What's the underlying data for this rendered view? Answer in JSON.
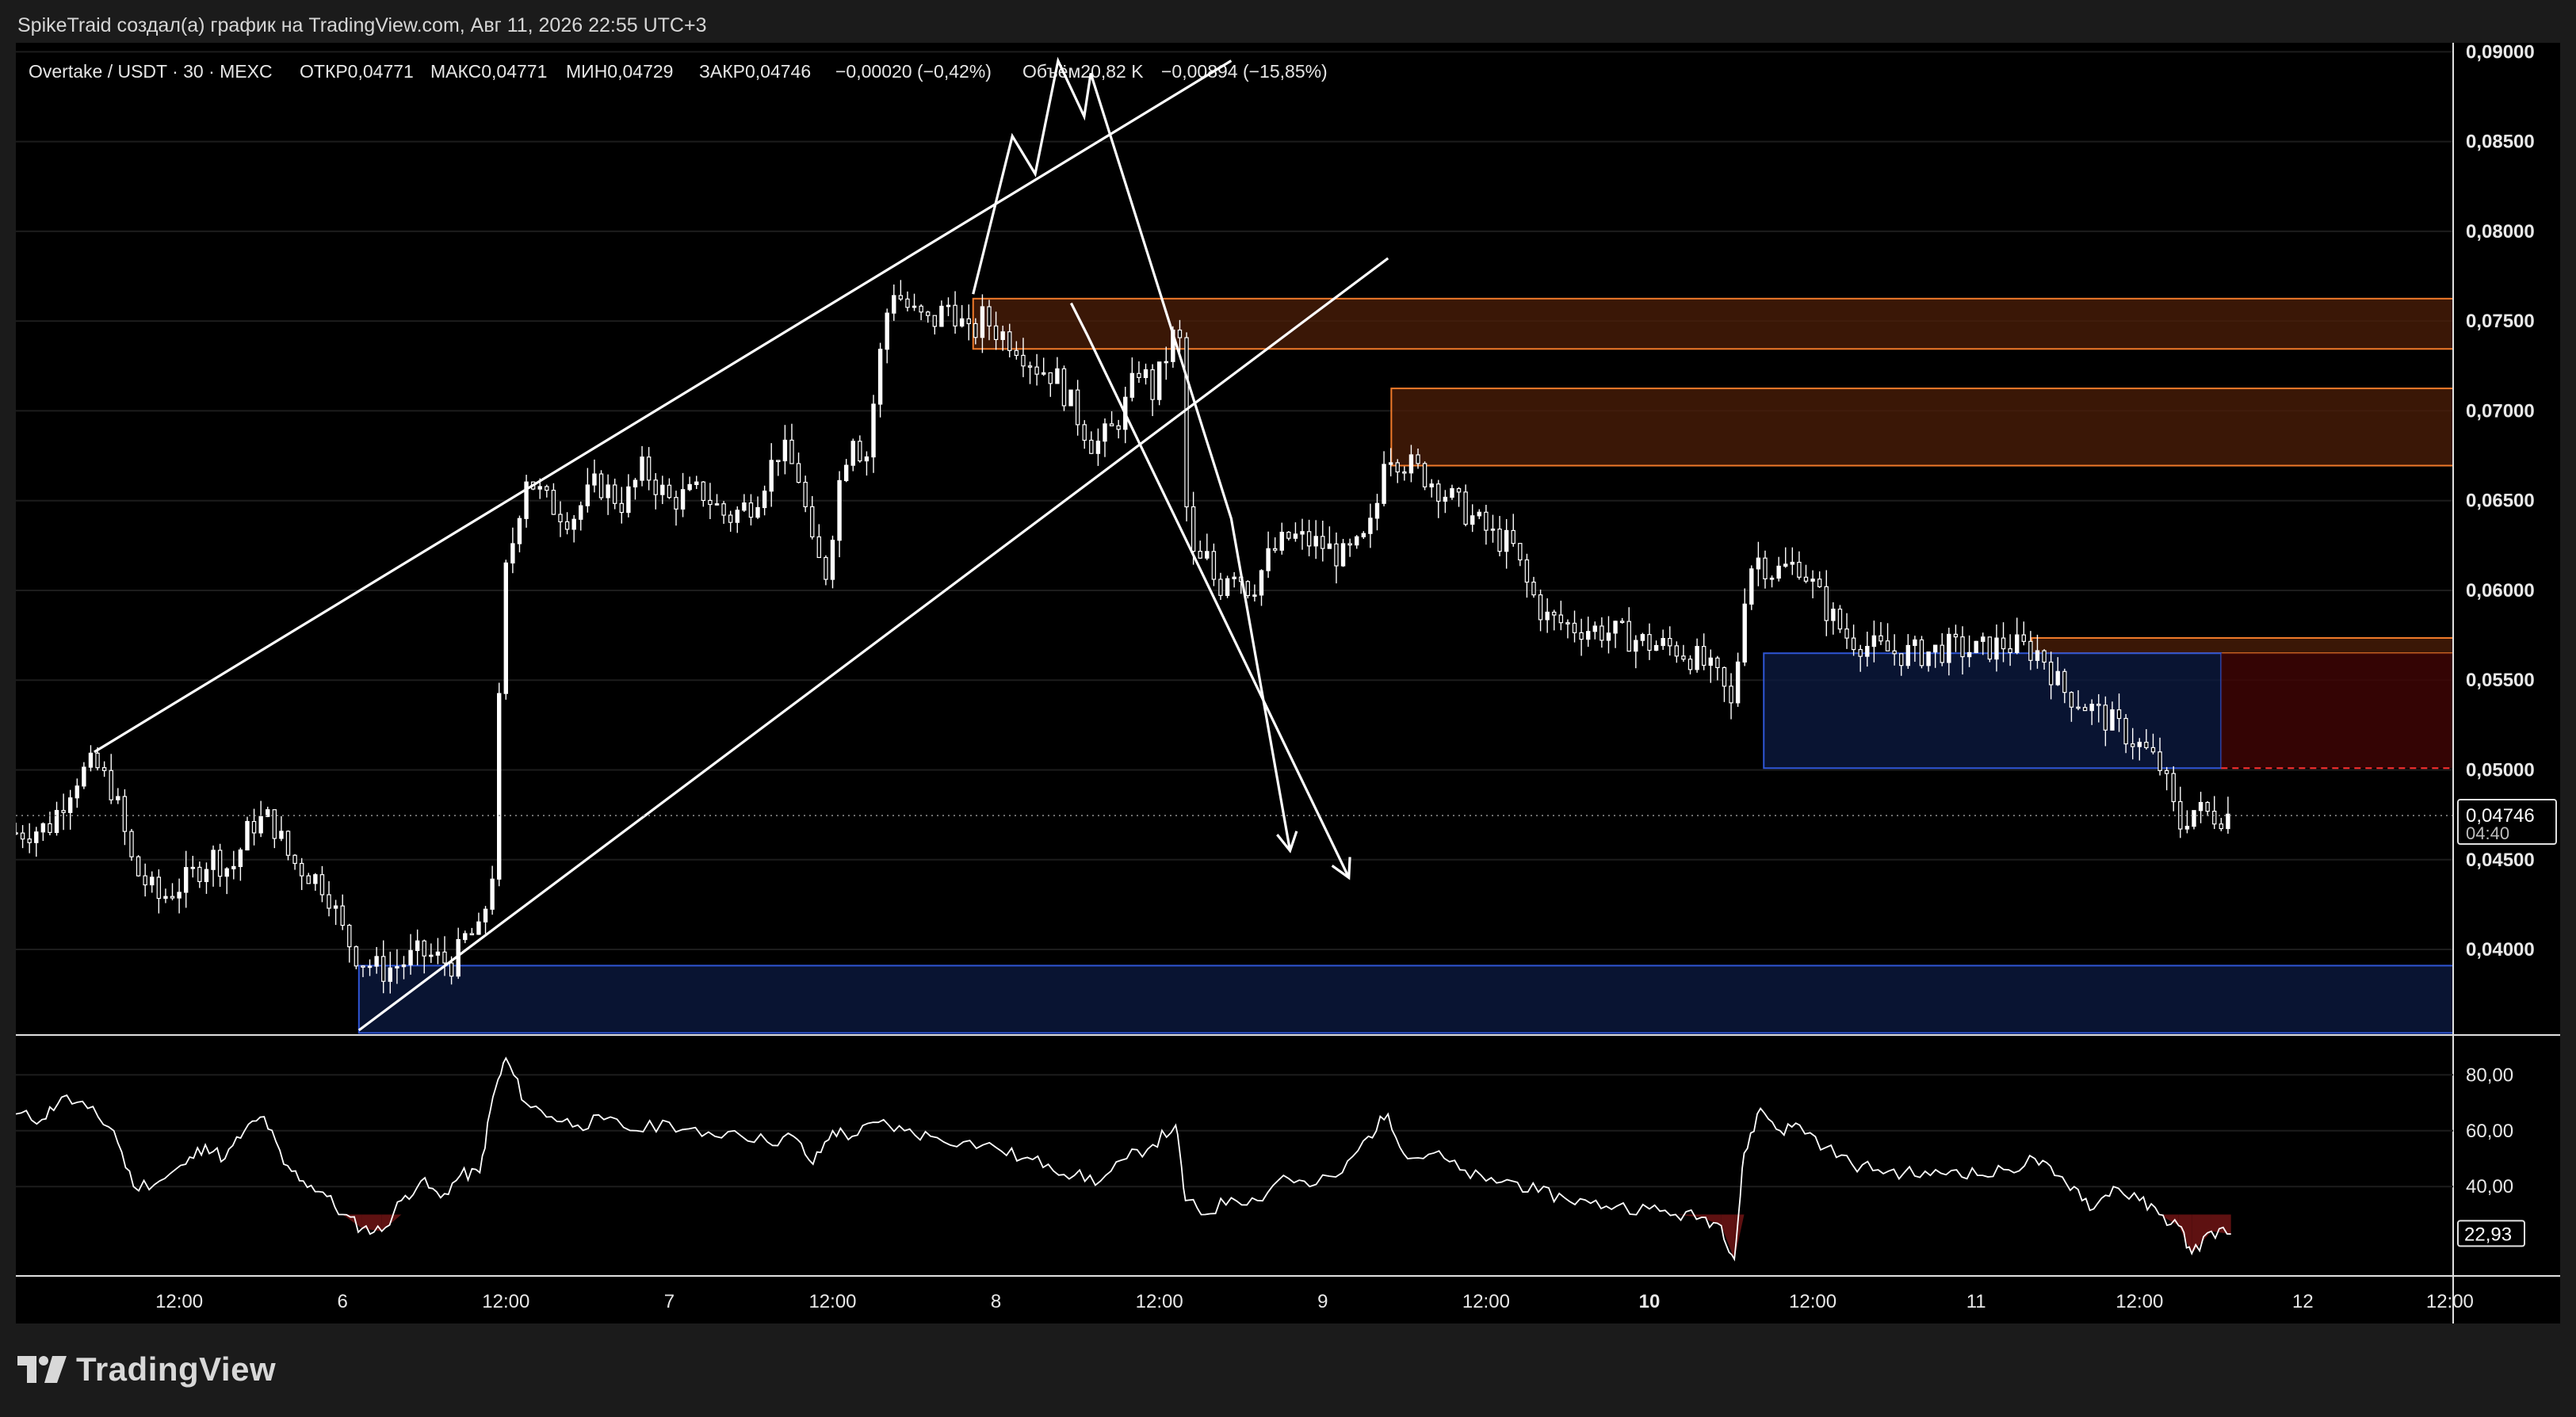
{
  "header": {
    "caption": "SpikeTraid создал(а) график на TradingView.com, Авг 11, 2026 22:55 UTC+3"
  },
  "footer": {
    "brand": "TradingView",
    "logo_icon": "tradingview-logo-icon"
  },
  "colors": {
    "background": "#000000",
    "page": "#1b1b1b",
    "candle": "#ffffff",
    "resistance_zone_fill": "#4a1e08",
    "resistance_zone_border": "#f07a2a",
    "support_zone_fill": "#0b1a40",
    "support_zone_border": "#2f56d6",
    "red_zone_fill": "#3d0505",
    "red_zone_dash": "#ff3030",
    "rsi_line": "#ffffff",
    "oversold_fill": "#6e1414"
  },
  "chart_data": [
    {
      "type": "candlestick",
      "legend": {
        "symbol": "Overtake / USDT · 30 · MEXC",
        "open": "ОТКР0,04771",
        "high": "МАКС0,04771",
        "low": "МИН0,04729",
        "close": "ЗАКР0,04746",
        "change": "−0,00020 (−0,42%)",
        "volume": "Объём20,82 K",
        "volume_change": "−0,00894 (−15,85%)"
      },
      "x_axis": {
        "tick_labels": [
          "12:00",
          "6",
          "12:00",
          "7",
          "12:00",
          "8",
          "12:00",
          "9",
          "12:00",
          "10",
          "12:00",
          "11",
          "12:00",
          "12",
          "12:00"
        ],
        "bold_ticks": [
          "10"
        ],
        "range_days": [
          5.0,
          12.46
        ]
      },
      "y_axis": {
        "tick_labels": [
          "0,09000",
          "0,08500",
          "0,08000",
          "0,07500",
          "0,07000",
          "0,06500",
          "0,06000",
          "0,05500",
          "0,05000",
          "0,04500",
          "0,04000"
        ],
        "range": [
          0.0355,
          0.0905
        ],
        "side": "right"
      },
      "last_price": {
        "value": 0.04746,
        "label": "0,04746",
        "countdown": "04:40"
      },
      "price_path": [
        [
          5.0,
          0.0465
        ],
        [
          5.1,
          0.0468
        ],
        [
          5.18,
          0.0495
        ],
        [
          5.24,
          0.0503
        ],
        [
          5.3,
          0.0488
        ],
        [
          5.36,
          0.0445
        ],
        [
          5.44,
          0.0428
        ],
        [
          5.52,
          0.0438
        ],
        [
          5.6,
          0.0452
        ],
        [
          5.66,
          0.0444
        ],
        [
          5.72,
          0.047
        ],
        [
          5.78,
          0.0473
        ],
        [
          5.84,
          0.045
        ],
        [
          5.9,
          0.0442
        ],
        [
          5.95,
          0.0435
        ],
        [
          6.0,
          0.041
        ],
        [
          6.05,
          0.0395
        ],
        [
          6.12,
          0.0388
        ],
        [
          6.18,
          0.0392
        ],
        [
          6.24,
          0.0398
        ],
        [
          6.3,
          0.0394
        ],
        [
          6.34,
          0.0392
        ],
        [
          6.38,
          0.0408
        ],
        [
          6.42,
          0.0408
        ],
        [
          6.46,
          0.0445
        ],
        [
          6.48,
          0.054
        ],
        [
          6.5,
          0.061
        ],
        [
          6.53,
          0.0635
        ],
        [
          6.56,
          0.0665
        ],
        [
          6.62,
          0.065
        ],
        [
          6.7,
          0.064
        ],
        [
          6.78,
          0.066
        ],
        [
          6.86,
          0.0648
        ],
        [
          6.92,
          0.0668
        ],
        [
          7.0,
          0.065
        ],
        [
          7.1,
          0.0655
        ],
        [
          7.18,
          0.064
        ],
        [
          7.26,
          0.065
        ],
        [
          7.34,
          0.068
        ],
        [
          7.4,
          0.0662
        ],
        [
          7.44,
          0.062
        ],
        [
          7.48,
          0.061
        ],
        [
          7.52,
          0.066
        ],
        [
          7.56,
          0.069
        ],
        [
          7.6,
          0.067
        ],
        [
          7.64,
          0.0725
        ],
        [
          7.68,
          0.077
        ],
        [
          7.74,
          0.0755
        ],
        [
          7.8,
          0.0748
        ],
        [
          7.86,
          0.076
        ],
        [
          7.92,
          0.074
        ],
        [
          7.96,
          0.0752
        ],
        [
          8.0,
          0.0745
        ],
        [
          8.06,
          0.0738
        ],
        [
          8.12,
          0.0725
        ],
        [
          8.18,
          0.072
        ],
        [
          8.24,
          0.07
        ],
        [
          8.3,
          0.068
        ],
        [
          8.36,
          0.069
        ],
        [
          8.4,
          0.0705
        ],
        [
          8.44,
          0.0725
        ],
        [
          8.48,
          0.071
        ],
        [
          8.52,
          0.073
        ],
        [
          8.56,
          0.075
        ],
        [
          8.58,
          0.065
        ],
        [
          8.61,
          0.061
        ],
        [
          8.64,
          0.062
        ],
        [
          8.68,
          0.06
        ],
        [
          8.72,
          0.0615
        ],
        [
          8.78,
          0.06
        ],
        [
          8.84,
          0.062
        ],
        [
          8.9,
          0.063
        ],
        [
          9.0,
          0.0625
        ],
        [
          9.06,
          0.0618
        ],
        [
          9.12,
          0.0625
        ],
        [
          9.16,
          0.064
        ],
        [
          9.19,
          0.068
        ],
        [
          9.22,
          0.0675
        ],
        [
          9.28,
          0.0668
        ],
        [
          9.34,
          0.066
        ],
        [
          9.4,
          0.065
        ],
        [
          9.46,
          0.064
        ],
        [
          9.52,
          0.063
        ],
        [
          9.58,
          0.0625
        ],
        [
          9.62,
          0.0605
        ],
        [
          9.68,
          0.0585
        ],
        [
          9.76,
          0.058
        ],
        [
          9.84,
          0.0578
        ],
        [
          9.92,
          0.0575
        ],
        [
          10.0,
          0.057
        ],
        [
          10.08,
          0.0568
        ],
        [
          10.16,
          0.056
        ],
        [
          10.22,
          0.0548
        ],
        [
          10.26,
          0.053
        ],
        [
          10.28,
          0.059
        ],
        [
          10.32,
          0.062
        ],
        [
          10.38,
          0.061
        ],
        [
          10.46,
          0.0615
        ],
        [
          10.54,
          0.059
        ],
        [
          10.6,
          0.0575
        ],
        [
          10.68,
          0.0568
        ],
        [
          10.76,
          0.0565
        ],
        [
          10.84,
          0.0565
        ],
        [
          10.92,
          0.0568
        ],
        [
          11.0,
          0.0566
        ],
        [
          11.08,
          0.057
        ],
        [
          11.14,
          0.0568
        ],
        [
          11.2,
          0.0565
        ],
        [
          11.26,
          0.0545
        ],
        [
          11.32,
          0.0538
        ],
        [
          11.4,
          0.0528
        ],
        [
          11.46,
          0.052
        ],
        [
          11.52,
          0.051
        ],
        [
          11.57,
          0.05
        ],
        [
          11.62,
          0.0468
        ],
        [
          11.66,
          0.0478
        ],
        [
          11.72,
          0.0475
        ],
        [
          11.78,
          0.0475
        ]
      ],
      "zones": [
        {
          "kind": "resistance",
          "from_day": 7.93,
          "to_day": 12.46,
          "top": 0.07625,
          "bottom": 0.07345
        },
        {
          "kind": "resistance",
          "from_day": 9.21,
          "to_day": 12.46,
          "top": 0.07125,
          "bottom": 0.06695
        },
        {
          "kind": "resistance",
          "from_day": 11.17,
          "to_day": 12.46,
          "top": 0.05735,
          "bottom": 0.0565
        },
        {
          "kind": "support",
          "from_day": 10.35,
          "to_day": 11.75,
          "top": 0.0565,
          "bottom": 0.0501
        },
        {
          "kind": "support",
          "from_day": 6.05,
          "to_day": 12.46,
          "top": 0.0391,
          "bottom": 0.03535
        },
        {
          "kind": "red",
          "from_day": 11.75,
          "to_day": 12.46,
          "top": 0.0565,
          "bottom": 0.0501,
          "dashed_bottom": true
        }
      ],
      "drawings": {
        "channel_upper": [
          [
            5.24,
            0.051
          ],
          [
            8.72,
            0.0895
          ]
        ],
        "channel_lower": [
          [
            6.05,
            0.0355
          ],
          [
            9.2,
            0.0785
          ]
        ],
        "projected_path": [
          [
            7.93,
            0.0765
          ],
          [
            8.05,
            0.0853
          ],
          [
            8.12,
            0.0832
          ],
          [
            8.19,
            0.0895
          ],
          [
            8.27,
            0.0864
          ],
          [
            8.29,
            0.0888
          ],
          [
            8.72,
            0.064
          ],
          [
            8.9,
            0.0455
          ]
        ],
        "projected_path_2": [
          [
            8.23,
            0.076
          ],
          [
            8.28,
            0.0742
          ],
          [
            9.08,
            0.044
          ]
        ]
      }
    },
    {
      "type": "line",
      "name": "RSI",
      "y_axis": {
        "tick_labels": [
          "80,00",
          "60,00",
          "40,00"
        ],
        "range": [
          8,
          92
        ]
      },
      "last_value": {
        "value": 22.93,
        "label": "22,93"
      },
      "series": [
        [
          5.0,
          66
        ],
        [
          5.08,
          64
        ],
        [
          5.14,
          72
        ],
        [
          5.22,
          68
        ],
        [
          5.3,
          60
        ],
        [
          5.36,
          40
        ],
        [
          5.44,
          42
        ],
        [
          5.52,
          48
        ],
        [
          5.58,
          55
        ],
        [
          5.64,
          50
        ],
        [
          5.7,
          60
        ],
        [
          5.76,
          65
        ],
        [
          5.82,
          48
        ],
        [
          5.88,
          42
        ],
        [
          5.94,
          38
        ],
        [
          6.0,
          30
        ],
        [
          6.06,
          25
        ],
        [
          6.12,
          24
        ],
        [
          6.18,
          35
        ],
        [
          6.24,
          42
        ],
        [
          6.3,
          36
        ],
        [
          6.36,
          44
        ],
        [
          6.42,
          45
        ],
        [
          6.46,
          72
        ],
        [
          6.5,
          86
        ],
        [
          6.56,
          70
        ],
        [
          6.64,
          65
        ],
        [
          6.72,
          62
        ],
        [
          6.8,
          64
        ],
        [
          6.9,
          60
        ],
        [
          7.0,
          63
        ],
        [
          7.1,
          58
        ],
        [
          7.2,
          60
        ],
        [
          7.3,
          56
        ],
        [
          7.38,
          58
        ],
        [
          7.44,
          48
        ],
        [
          7.5,
          60
        ],
        [
          7.56,
          58
        ],
        [
          7.64,
          63
        ],
        [
          7.72,
          60
        ],
        [
          7.8,
          58
        ],
        [
          7.9,
          56
        ],
        [
          8.0,
          54
        ],
        [
          8.08,
          50
        ],
        [
          8.16,
          48
        ],
        [
          8.24,
          44
        ],
        [
          8.32,
          42
        ],
        [
          8.4,
          50
        ],
        [
          8.48,
          55
        ],
        [
          8.55,
          62
        ],
        [
          8.58,
          35
        ],
        [
          8.64,
          30
        ],
        [
          8.72,
          36
        ],
        [
          8.8,
          35
        ],
        [
          8.88,
          44
        ],
        [
          8.96,
          40
        ],
        [
          9.06,
          45
        ],
        [
          9.14,
          58
        ],
        [
          9.2,
          66
        ],
        [
          9.26,
          50
        ],
        [
          9.34,
          52
        ],
        [
          9.42,
          46
        ],
        [
          9.5,
          42
        ],
        [
          9.58,
          42
        ],
        [
          9.66,
          38
        ],
        [
          9.74,
          36
        ],
        [
          9.82,
          34
        ],
        [
          9.9,
          33
        ],
        [
          10.0,
          32
        ],
        [
          10.08,
          30
        ],
        [
          10.16,
          29
        ],
        [
          10.22,
          26
        ],
        [
          10.26,
          14
        ],
        [
          10.29,
          52
        ],
        [
          10.34,
          68
        ],
        [
          10.4,
          60
        ],
        [
          10.46,
          62
        ],
        [
          10.54,
          54
        ],
        [
          10.62,
          48
        ],
        [
          10.7,
          46
        ],
        [
          10.78,
          45
        ],
        [
          10.86,
          44
        ],
        [
          10.94,
          46
        ],
        [
          11.02,
          44
        ],
        [
          11.1,
          46
        ],
        [
          11.18,
          50
        ],
        [
          11.24,
          44
        ],
        [
          11.3,
          40
        ],
        [
          11.36,
          32
        ],
        [
          11.42,
          40
        ],
        [
          11.5,
          35
        ],
        [
          11.56,
          30
        ],
        [
          11.62,
          26
        ],
        [
          11.66,
          16
        ],
        [
          11.72,
          24
        ],
        [
          11.78,
          23
        ]
      ]
    }
  ]
}
